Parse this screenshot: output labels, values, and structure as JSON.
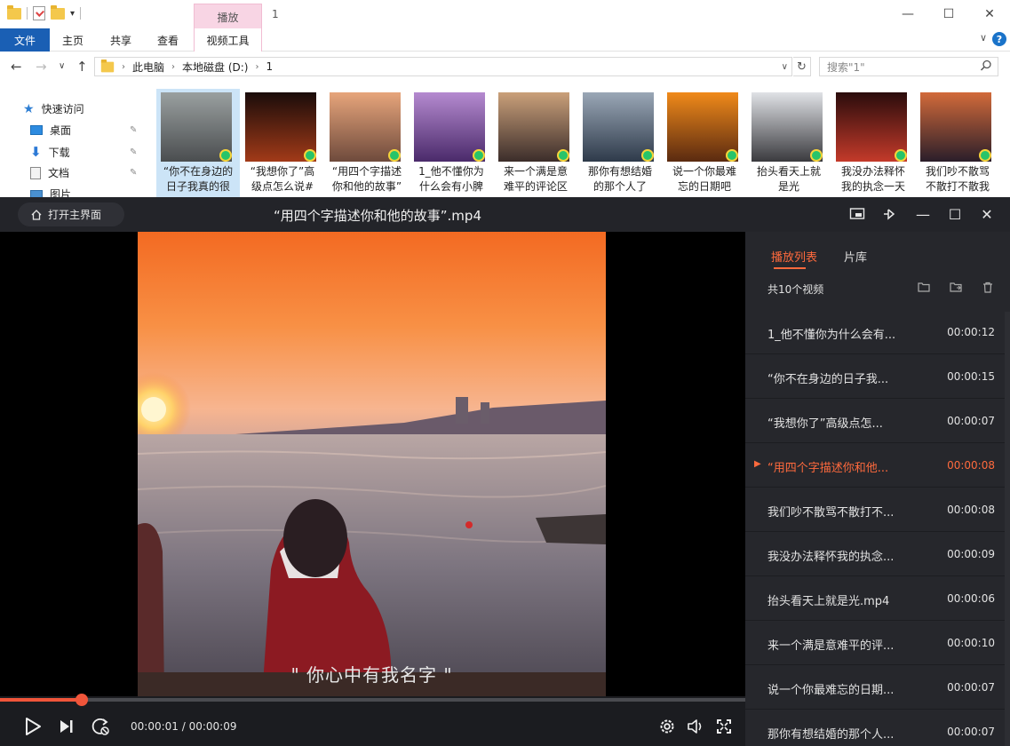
{
  "explorer": {
    "context_tab": "播放",
    "window_title": "1",
    "ribbon_tabs": [
      "文件",
      "主页",
      "共享",
      "查看",
      "视频工具"
    ],
    "address": {
      "crumbs": [
        "此电脑",
        "本地磁盘 (D:)",
        "1"
      ]
    },
    "search_placeholder": "搜索\"1\"",
    "nav_items": [
      {
        "label": "快速访问",
        "icon": "star-icon"
      },
      {
        "label": "桌面",
        "icon": "desktop-icon"
      },
      {
        "label": "下载",
        "icon": "download-icon"
      },
      {
        "label": "文档",
        "icon": "document-icon"
      },
      {
        "label": "图片",
        "icon": "picture-icon"
      }
    ],
    "thumbnails": [
      {
        "line1": "“你不在身边的",
        "line2": "日子我真的很",
        "colors": [
          "#9aa0a0",
          "#4a4d4f"
        ]
      },
      {
        "line1": "“我想你了”高",
        "line2": "级点怎么说#",
        "colors": [
          "#1a0c0a",
          "#a23a18"
        ]
      },
      {
        "line1": "“用四个字描述",
        "line2": "你和他的故事”",
        "colors": [
          "#e7a57b",
          "#6e4a3c"
        ]
      },
      {
        "line1": "1_他不懂你为",
        "line2": "什么会有小脾",
        "colors": [
          "#b58ad0",
          "#4a2a6a"
        ]
      },
      {
        "line1": "来一个满是意",
        "line2": "难平的评论区",
        "colors": [
          "#caa07a",
          "#3b2d2a"
        ]
      },
      {
        "line1": "那你有想结婚",
        "line2": "的那个人了",
        "colors": [
          "#9aa7b6",
          "#2e3a4a"
        ]
      },
      {
        "line1": "说一个你最难",
        "line2": "忘的日期吧",
        "colors": [
          "#f08a1a",
          "#5a2a10"
        ]
      },
      {
        "line1": "抬头看天上就",
        "line2": "是光",
        "colors": [
          "#e0e2e6",
          "#3a3a3e"
        ]
      },
      {
        "line1": "我没办法释怀",
        "line2": "我的执念一天",
        "colors": [
          "#2a0c0c",
          "#c43a2a"
        ]
      },
      {
        "line1": "我们吵不散骂",
        "line2": "不散打不散我",
        "colors": [
          "#d26a3a",
          "#2a1e2a"
        ]
      }
    ]
  },
  "player": {
    "home_button": "打开主界面",
    "title": "“用四个字描述你和他的故事”.mp4",
    "subtitle": "\" 你心中有我名字 \"",
    "current_time": "00:00:01",
    "total_time": "00:00:09",
    "time_display": "00:00:01 / 00:00:09",
    "progress_fraction": 0.11,
    "accent_color": "#ff6a3d"
  },
  "sidebar": {
    "tabs": [
      "播放列表",
      "片库"
    ],
    "count_label": "共10个视频",
    "items": [
      {
        "name": "1_他不懂你为什么会有...",
        "duration": "00:00:12",
        "current": false
      },
      {
        "name": "“你不在身边的日子我...",
        "duration": "00:00:15",
        "current": false
      },
      {
        "name": "“我想你了”高级点怎...",
        "duration": "00:00:07",
        "current": false
      },
      {
        "name": "“用四个字描述你和他...",
        "duration": "00:00:08",
        "current": true
      },
      {
        "name": "我们吵不散骂不散打不...",
        "duration": "00:00:08",
        "current": false
      },
      {
        "name": "我没办法释怀我的执念...",
        "duration": "00:00:09",
        "current": false
      },
      {
        "name": "抬头看天上就是光.mp4",
        "duration": "00:00:06",
        "current": false
      },
      {
        "name": "来一个满是意难平的评...",
        "duration": "00:00:10",
        "current": false
      },
      {
        "name": "说一个你最难忘的日期...",
        "duration": "00:00:07",
        "current": false
      },
      {
        "name": "那你有想结婚的那个人...",
        "duration": "00:00:07",
        "current": false
      }
    ]
  }
}
